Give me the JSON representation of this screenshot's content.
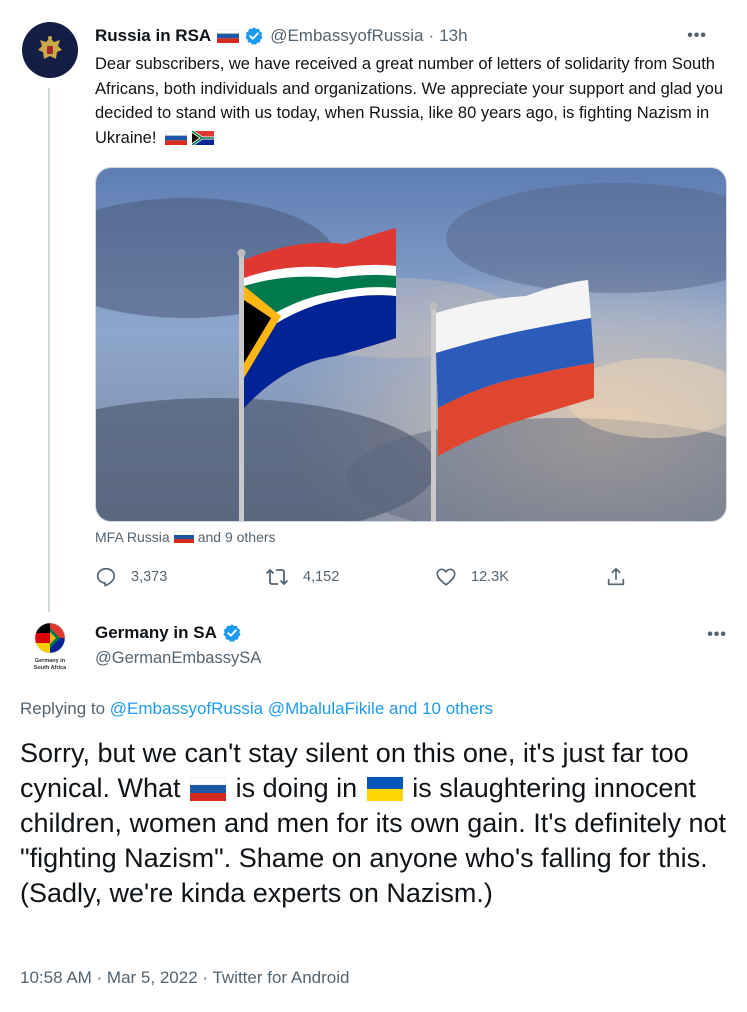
{
  "tweet1": {
    "author_name": "Russia in RSA",
    "handle": "@EmbassyofRussia",
    "time": "13h",
    "more_label": "•••",
    "text": "Dear subscribers, we have received a great number of letters of solidarity from South Africans, both individuals and organizations. We appreciate your support and glad you decided to stand with us today, when Russia, like 80 years ago, is fighting Nazism in Ukraine!",
    "liked_by_name": "MFA Russia",
    "liked_by_others": "and 9 others",
    "replies": "3,373",
    "retweets": "4,152",
    "likes": "12.3K"
  },
  "tweet2": {
    "author_name": "Germany in SA",
    "handle": "@GermanEmbassySA",
    "avatar_caption_line1": "Germany in",
    "avatar_caption_line2": "South Africa",
    "more_label": "•••",
    "replying_prefix": "Replying to",
    "replying_users": "@EmbassyofRussia @MbalulaFikile and 10 others",
    "text_part1": "Sorry, but we can't stay silent on this one, it's just far too cynical. What",
    "text_part2": "is doing in",
    "text_part3": "is slaughtering innocent children, women and men for its own gain. It's definitely not \"fighting Nazism\". Shame on anyone who's falling for this. (Sadly, we're kinda experts on Nazism.)",
    "timestamp": "10:58 AM · Mar 5, 2022 · Twitter for Android"
  },
  "separator": "·",
  "colors": {
    "link": "#1d9bf0",
    "muted": "#536471",
    "verified": "#1d9bf0",
    "thread_line": "#cfd9de"
  },
  "icons": [
    "reply-icon",
    "retweet-icon",
    "like-icon",
    "share-icon",
    "verified-icon",
    "russia-flag-icon",
    "south-africa-flag-icon",
    "ukraine-flag-icon"
  ]
}
